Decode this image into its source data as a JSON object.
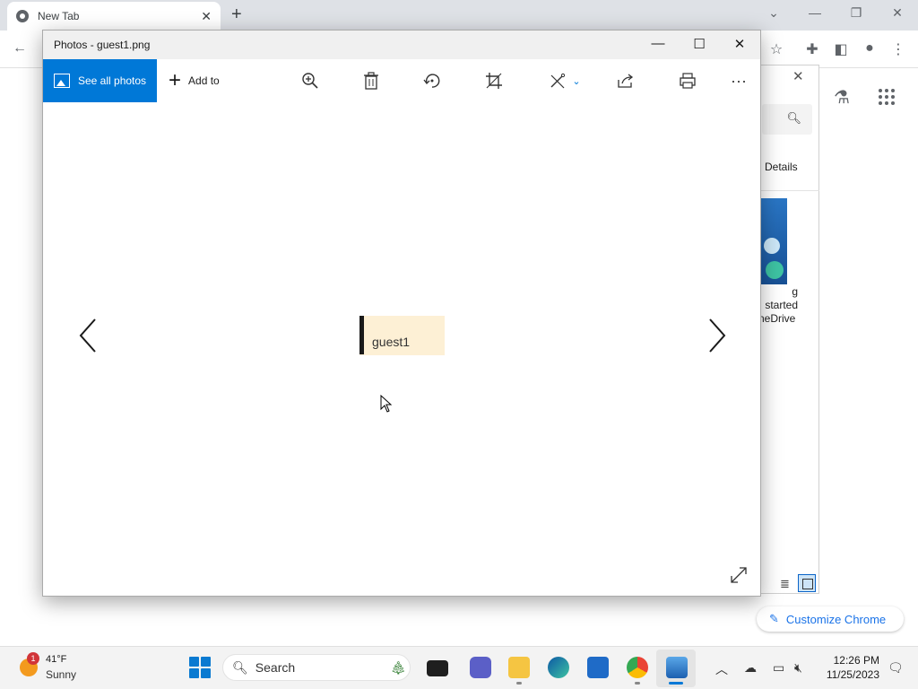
{
  "browser": {
    "tab_title": "New Tab",
    "tab_close": "✕",
    "new_tab": "+",
    "window_controls": [
      "⌄",
      "—",
      "❐",
      "✕"
    ],
    "toolbar_icons": [
      "back-icon",
      "star-icon",
      "extensions-icon",
      "side-panel-icon",
      "profile-icon",
      "menu-icon"
    ]
  },
  "ntp": {
    "customize_label": "Customize Chrome",
    "labs_icon": "flask-icon",
    "apps_icon": "apps-grid-icon"
  },
  "explorer": {
    "close": "✕",
    "details_label": "Details",
    "item_caption_line1": "g started",
    "item_caption_line2": "neDrive"
  },
  "photos": {
    "title": "Photos - guest1.png",
    "window_controls": [
      "—",
      "☐",
      "✕"
    ],
    "see_all_label": "See all photos",
    "add_to_label": "Add to",
    "commands": [
      {
        "name": "zoom-icon"
      },
      {
        "name": "delete-icon"
      },
      {
        "name": "rotate-icon"
      },
      {
        "name": "crop-icon"
      },
      {
        "name": "edit-create-icon"
      },
      {
        "name": "share-icon"
      },
      {
        "name": "print-icon"
      },
      {
        "name": "more-icon",
        "glyph": "···"
      }
    ],
    "image_text": "guest1"
  },
  "taskbar": {
    "weather_badge": "1",
    "temperature": "41°F",
    "condition": "Sunny",
    "search_placeholder": "Search",
    "time": "12:26 PM",
    "date": "11/25/2023",
    "accent": "#0078d7"
  }
}
